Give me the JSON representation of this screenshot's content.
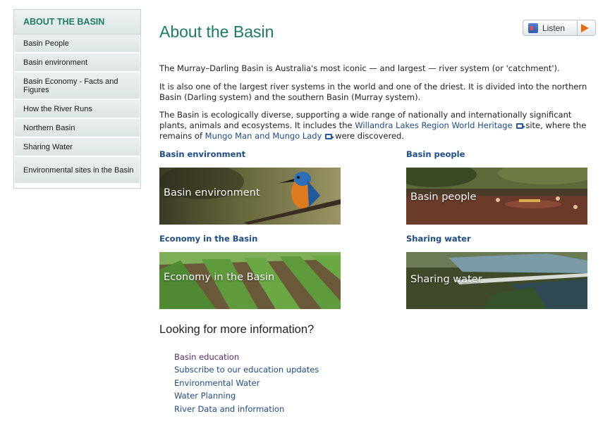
{
  "sidebar": {
    "heading": "ABOUT THE BASIN",
    "items": [
      {
        "label": "Basin People"
      },
      {
        "label": "Basin environment"
      },
      {
        "label": "Basin Economy - Facts and Figures"
      },
      {
        "label": "How the River Runs"
      },
      {
        "label": "Northern Basin"
      },
      {
        "label": "Sharing Water"
      },
      {
        "label": "Environmental sites in the Basin"
      }
    ]
  },
  "page": {
    "title": "About the Basin",
    "listen_label": "Listen",
    "para1": "The Murray–Darling Basin is Australia's most iconic — and largest — river system (or 'catchment').",
    "para2": "It is also one of the largest river systems in the world and one of the driest. It is divided into the northern Basin (Darling system) and the southern Basin (Murray system).",
    "para3_a": "The Basin is ecologically diverse, supporting a wide range of nationally and internationally significant plants, animals and ecosystems. It includes the ",
    "para3_link1": "Willandra Lakes Region World Heritage",
    "para3_b": " site, where the remains of ",
    "para3_link2": "Mungo Man and Mungo Lady",
    "para3_c": " were discovered."
  },
  "sections": [
    {
      "title": "Basin environment",
      "caption": "Basin environment"
    },
    {
      "title": "Basin people",
      "caption": "Basin people"
    },
    {
      "title": "Economy in the Basin",
      "caption": "Economy in the Basin"
    },
    {
      "title": "Sharing water",
      "caption": "Sharing water"
    }
  ],
  "more": {
    "title": "Looking for more information?",
    "links": [
      {
        "label": "Basin education"
      },
      {
        "label": "Subscribe to our education updates"
      },
      {
        "label": "Environmental Water"
      },
      {
        "label": "Water Planning"
      },
      {
        "label": "River Data and information"
      }
    ]
  },
  "colors": {
    "brand_green": "#1d7a64",
    "link_blue": "#1e4b8a",
    "visited_purple": "#5a2a6e"
  },
  "icons": {
    "listen": "speaker-icon",
    "play": "play-icon",
    "external": "external-link-icon"
  }
}
